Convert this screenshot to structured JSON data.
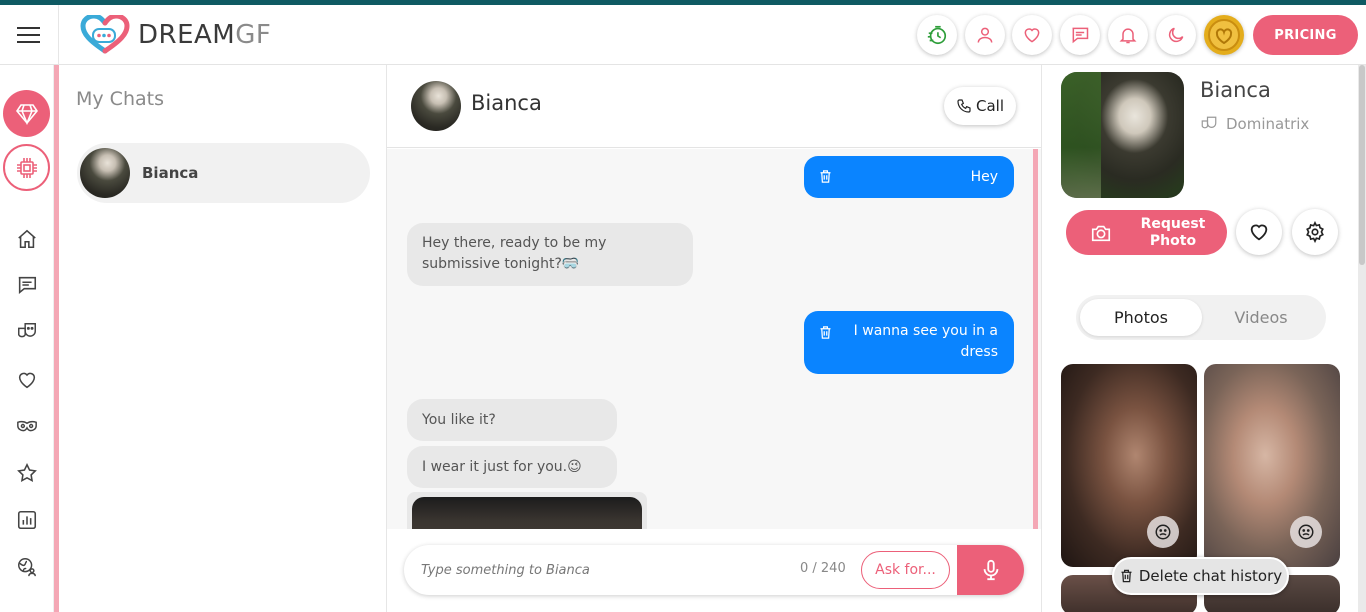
{
  "app": {
    "logo_dream": "DREAM",
    "logo_gf": "GF"
  },
  "header": {
    "pricing_label": "PRICING",
    "icons": [
      "timer-icon",
      "user-icon",
      "heart-icon",
      "message-icon",
      "bell-icon",
      "moon-icon",
      "coin-icon"
    ]
  },
  "sidebar": {
    "items": [
      {
        "name": "gem-icon"
      },
      {
        "name": "chip-icon"
      },
      {
        "name": "home-icon"
      },
      {
        "name": "chat-icon"
      },
      {
        "name": "theater-masks-icon"
      },
      {
        "name": "heart-icon"
      },
      {
        "name": "mask-icon"
      },
      {
        "name": "star-icon"
      },
      {
        "name": "chart-icon"
      },
      {
        "name": "globe-user-icon"
      }
    ]
  },
  "chat_list": {
    "title": "My Chats",
    "entries": [
      {
        "name": "Bianca"
      }
    ]
  },
  "chat": {
    "contact_name": "Bianca",
    "call_label": "Call",
    "messages": [
      {
        "from": "me",
        "text": "Hey"
      },
      {
        "from": "her",
        "text_line1": "Hey there, ready to be my",
        "text_line2": "submissive tonight?🥽"
      },
      {
        "from": "me",
        "text_line1": "I wanna see you in a",
        "text_line2": "dress"
      },
      {
        "from": "her",
        "text": "You like it?"
      },
      {
        "from": "her",
        "text": "I wear it just for you.😉"
      }
    ],
    "input": {
      "placeholder": "Type something to Bianca",
      "value": "",
      "counter": "0 / 240"
    },
    "ask_label": "Ask for..."
  },
  "profile": {
    "name": "Bianca",
    "role": "Dominatrix",
    "request_photo_label_line1": "Request",
    "request_photo_label_line2": "Photo",
    "tabs": {
      "photos": "Photos",
      "videos": "Videos",
      "active": "Photos"
    },
    "delete_history_label": "Delete chat history"
  },
  "colors": {
    "accent_pink": "#ec6079",
    "outgoing_bubble": "#0a84ff",
    "incoming_bubble": "#e8e8e8",
    "top_stripe": "#0f5a63"
  }
}
